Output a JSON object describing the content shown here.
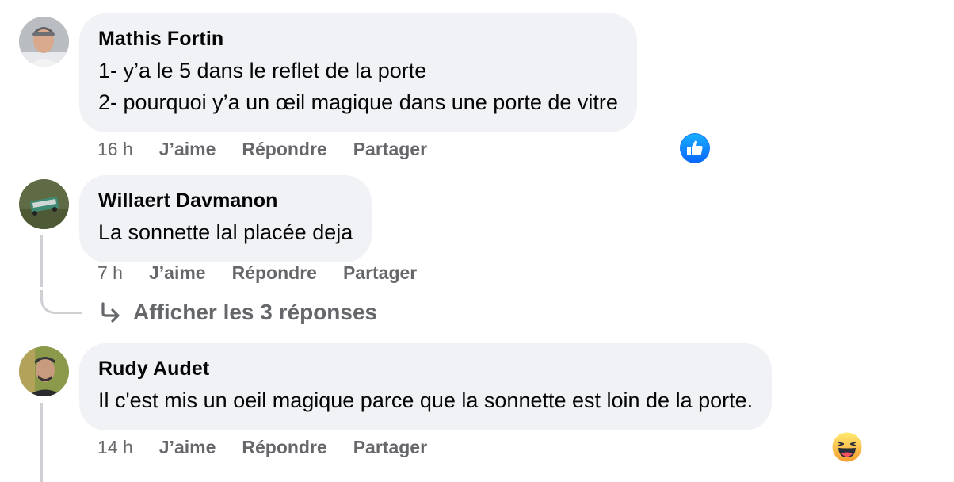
{
  "comments": [
    {
      "author": "Mathis Fortin",
      "lines": [
        "1- y’a le 5 dans le reflet de la porte",
        "2- pourquoi y’a un œil magique dans une porte de vitre"
      ],
      "time": "16 h",
      "like": "J’aime",
      "reply": "Répondre",
      "share": "Partager",
      "reaction": "like-icon"
    },
    {
      "author": "Willaert Davmanon",
      "lines": [
        "La sonnette lal placée deja"
      ],
      "time": "7 h",
      "like": "J’aime",
      "reply": "Répondre",
      "share": "Partager",
      "view_replies": "Afficher les 3 réponses"
    },
    {
      "author": "Rudy Audet",
      "lines": [
        "Il c'est mis un oeil magique parce que la sonnette est loin de la porte."
      ],
      "time": "14 h",
      "like": "J’aime",
      "reply": "Répondre",
      "share": "Partager",
      "reaction": "haha-icon"
    }
  ],
  "colors": {
    "bubble": "#f0f2f5",
    "meta_text": "#65676b",
    "like_blue": "#1877f2",
    "haha_yellow": "#f7b125"
  }
}
